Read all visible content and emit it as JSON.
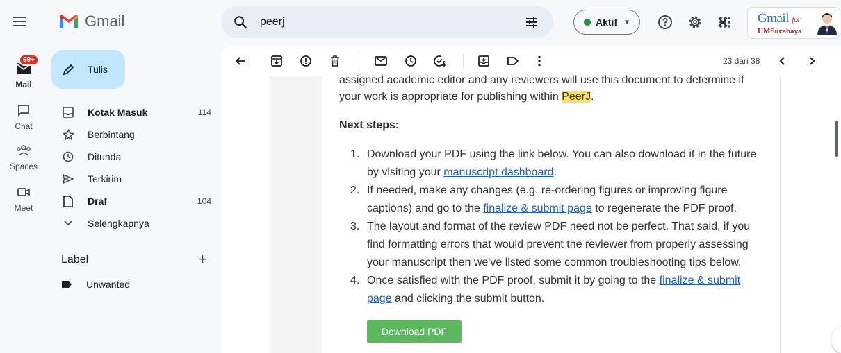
{
  "app": {
    "name": "Gmail"
  },
  "search": {
    "value": "peerj"
  },
  "status": {
    "label": "Aktif"
  },
  "brand": {
    "line1": "Gmail",
    "line1_suffix": "for",
    "line2": "UMSurabaya"
  },
  "rail": [
    {
      "label": "Mail",
      "badge": "99+"
    },
    {
      "label": "Chat"
    },
    {
      "label": "Spaces"
    },
    {
      "label": "Meet"
    }
  ],
  "compose": {
    "label": "Tulis"
  },
  "nav": [
    {
      "label": "Kotak Masuk",
      "count": "114"
    },
    {
      "label": "Berbintang",
      "count": ""
    },
    {
      "label": "Ditunda",
      "count": ""
    },
    {
      "label": "Terkirim",
      "count": ""
    },
    {
      "label": "Draf",
      "count": "104"
    },
    {
      "label": "Selengkapnya",
      "count": ""
    }
  ],
  "labels": {
    "heading": "Label",
    "items": [
      {
        "name": "Unwanted"
      }
    ]
  },
  "pager": {
    "text": "23 dari 38"
  },
  "email": {
    "intro_part1": "assigned academic editor and any reviewers will use this document to determine if your work is appropriate for publishing within ",
    "intro_highlight": "PeerJ",
    "intro_part2": ".",
    "next_steps": "Next steps:",
    "steps": [
      {
        "num": "1.",
        "a": "Download your PDF using the link below. You can also download it in the future by visiting your ",
        "link": "manuscript dashboard",
        "b": "."
      },
      {
        "num": "2.",
        "a": "If needed, make any changes (e.g. re-ordering figures or improving figure captions) and go to the ",
        "link": "finalize & submit page",
        "b": " to regenerate the PDF proof."
      },
      {
        "num": "3.",
        "a": "The layout and format of the review PDF need not be perfect. That said, if you find formatting errors that would prevent the reviewer from properly assessing your manuscript then we've listed some common troubleshooting tips below.",
        "link": "",
        "b": ""
      },
      {
        "num": "4.",
        "a": "Once satisfied with the PDF proof, submit it by going to the ",
        "link": "finalize & submit page",
        "b": " and clicking the submit button."
      }
    ],
    "download_button": "Download PDF"
  }
}
